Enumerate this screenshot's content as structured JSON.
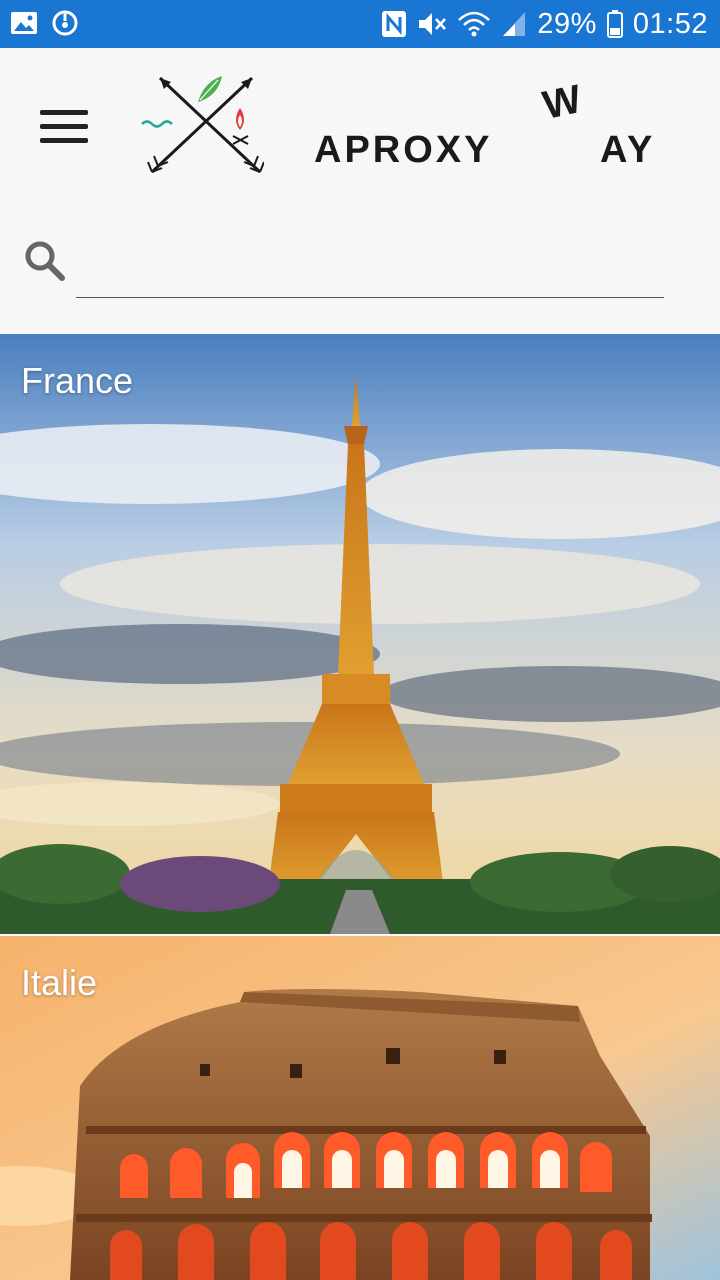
{
  "status_bar": {
    "battery": "29%",
    "time": "01:52",
    "icons": [
      "gallery-icon",
      "sync-icon",
      "nfc-icon",
      "mute-icon",
      "wifi-icon",
      "signal-icon",
      "battery-icon"
    ]
  },
  "header": {
    "menu_icon": "menu-icon",
    "logo_letters_left": "APROXY",
    "logo_letter_w": "W",
    "logo_letters_right": "AY"
  },
  "search": {
    "icon": "search-icon",
    "value": "",
    "placeholder": ""
  },
  "destinations": [
    {
      "name": "France"
    },
    {
      "name": "Italie"
    }
  ],
  "colors": {
    "status_bar": "#1976d2",
    "background": "#f7f7f7",
    "logo_dark": "#1a1a1a",
    "logo_leaf": "#4caf50",
    "logo_flame": "#e53935",
    "logo_water": "#26a69a"
  }
}
